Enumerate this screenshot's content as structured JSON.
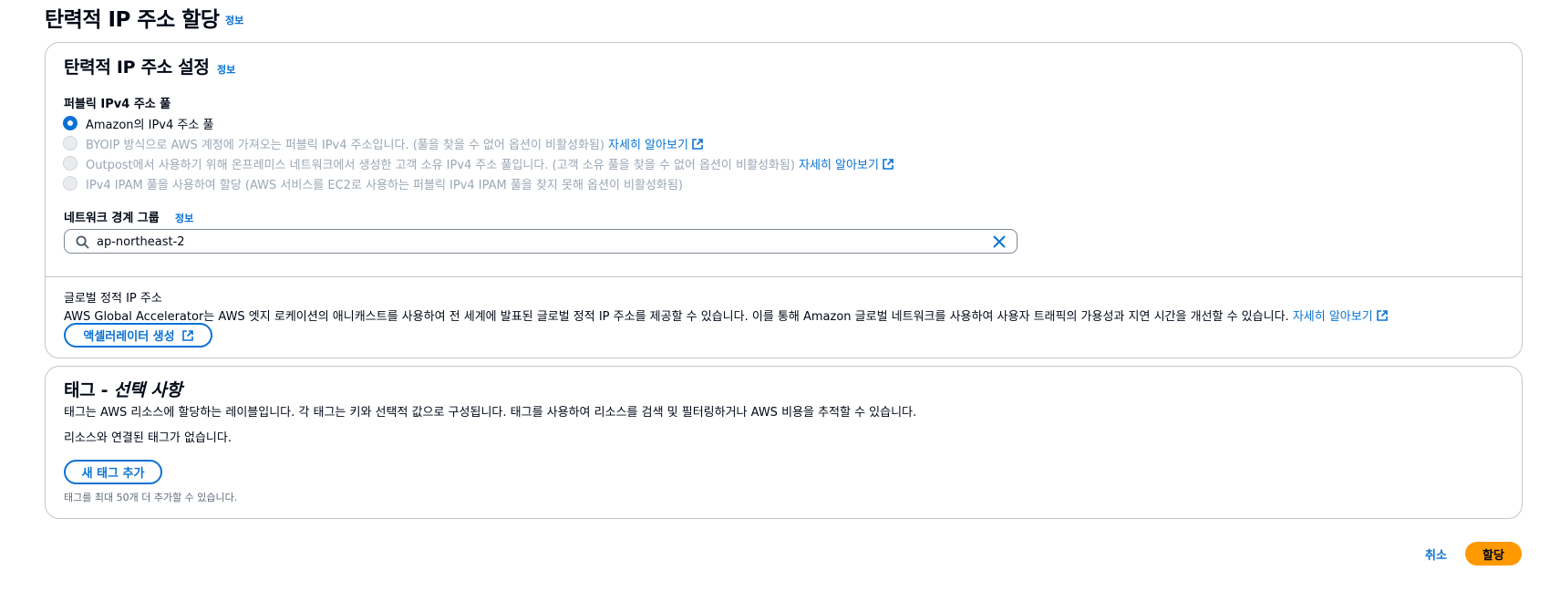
{
  "page": {
    "title": "탄력적 IP 주소 할당",
    "info": "정보"
  },
  "settings": {
    "title": "탄력적 IP 주소 설정",
    "info": "정보",
    "pool_label": "퍼블릭 IPv4 주소 풀",
    "options": [
      {
        "label": "Amazon의 IPv4 주소 풀",
        "selected": true,
        "disabled": false,
        "link": ""
      },
      {
        "label": "BYOIP 방식으로 AWS 계정에 가져오는 퍼블릭 IPv4 주소입니다. (풀을 찾을 수 없어 옵션이 비활성화됨)",
        "selected": false,
        "disabled": true,
        "link": "자세히 알아보기"
      },
      {
        "label": "Outpost에서 사용하기 위해 온프레미스 네트워크에서 생성한 고객 소유 IPv4 주소 풀입니다. (고객 소유 풀을 찾을 수 없어 옵션이 비활성화됨)",
        "selected": false,
        "disabled": true,
        "link": "자세히 알아보기"
      },
      {
        "label": "IPv4 IPAM 풀을 사용하여 할당 (AWS 서비스를 EC2로 사용하는 퍼블릭 IPv4 IPAM 풀을 찾지 못해 옵션이 비활성화됨)",
        "selected": false,
        "disabled": true,
        "link": ""
      }
    ],
    "network_border_label": "네트워크 경계 그룹",
    "network_border_info": "정보",
    "network_border_value": "ap-northeast-2"
  },
  "global": {
    "title": "글로벌 정적 IP 주소",
    "description": "AWS Global Accelerator는 AWS 엣지 로케이션의 애니캐스트를 사용하여 전 세계에 발표된 글로벌 정적 IP 주소를 제공할 수 있습니다. 이를 통해 Amazon 글로벌 네트워크를 사용하여 사용자 트래픽의 가용성과 지연 시간을 개선할 수 있습니다.",
    "learn_more": "자세히 알아보기",
    "create_button": "액셀러레이터 생성"
  },
  "tags": {
    "title": "태그 - ",
    "title_optional": "선택 사항",
    "description": "태그는 AWS 리소스에 할당하는 레이블입니다. 각 태그는 키와 선택적 값으로 구성됩니다. 태그를 사용하여 리소스를 검색 및 필터링하거나 AWS 비용을 추적할 수 있습니다.",
    "empty": "리소스와 연결된 태그가 없습니다.",
    "add_button": "새 태그 추가",
    "limit_note": "태그를 최대 50개 더 추가할 수 있습니다."
  },
  "footer": {
    "cancel": "취소",
    "submit": "할당"
  },
  "colors": {
    "accent": "#0972d3",
    "primary_button": "#ff9900",
    "disabled_text": "#9ba7b6"
  }
}
